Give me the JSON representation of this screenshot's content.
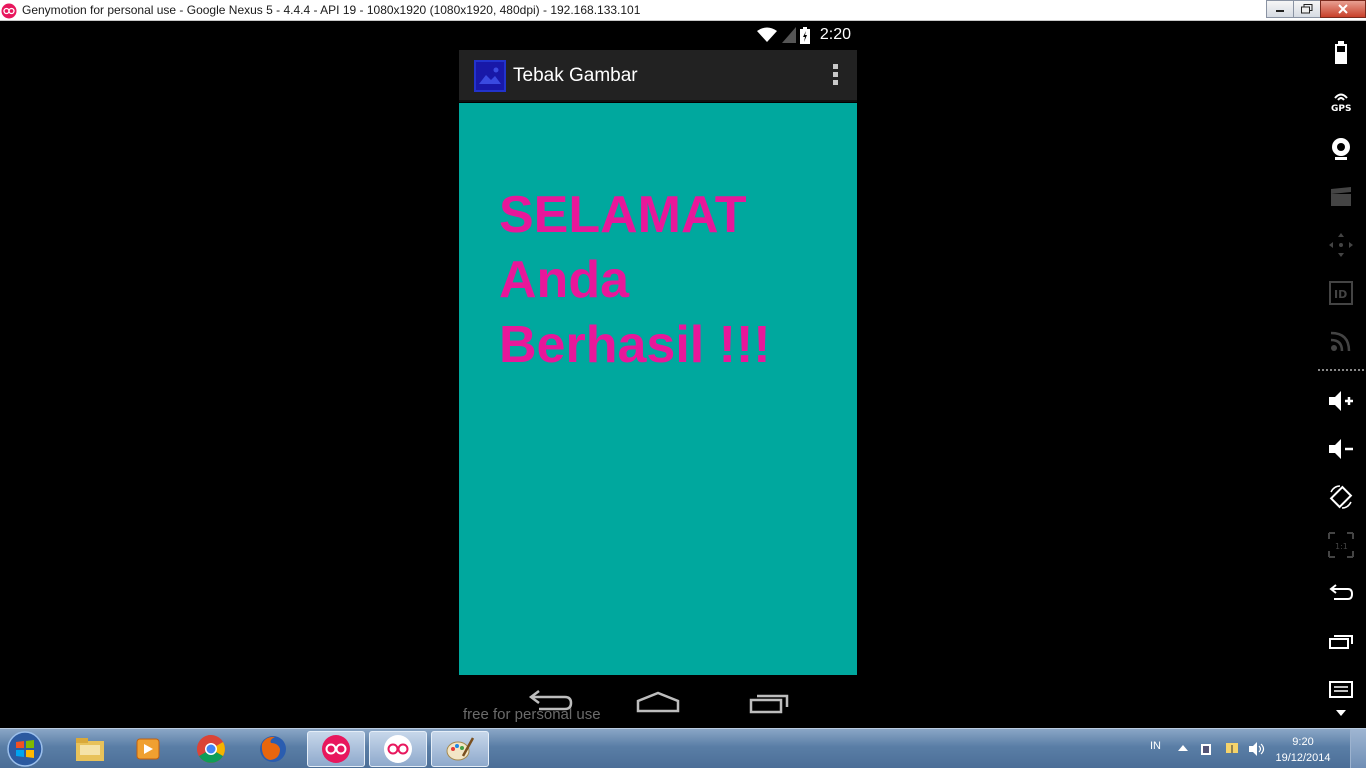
{
  "window": {
    "title": "Genymotion for personal use - Google Nexus 5 - 4.4.4 - API 19 - 1080x1920 (1080x1920, 480dpi) - 192.168.133.101",
    "controls": [
      "minimize",
      "restore",
      "close"
    ]
  },
  "status_bar": {
    "time": "2:20",
    "icons": [
      "wifi-icon",
      "signal-icon",
      "battery-charging-icon"
    ]
  },
  "action_bar": {
    "app_name": "Tebak Gambar",
    "logo_icon": "app-logo-icon",
    "menu_icon": "overflow-menu-icon"
  },
  "content": {
    "message": "SELAMAT Anda Berhasil !!!",
    "background_color": "#00a89e",
    "text_color": "#e8179a"
  },
  "nav_bar": {
    "buttons": [
      "back",
      "home",
      "recent-apps"
    ]
  },
  "watermark": "free for personal use",
  "sidebar": {
    "items": [
      "battery",
      "gps",
      "webcam",
      "capture",
      "dpad",
      "id",
      "remote-control",
      "volume-up",
      "volume-down",
      "rotate",
      "scale",
      "back",
      "recent-apps",
      "menu"
    ]
  },
  "taskbar": {
    "apps": [
      "file-explorer",
      "media-player",
      "chrome",
      "firefox",
      "genymotion",
      "genymotion-vm",
      "paint"
    ],
    "language": "IN",
    "clock_time": "9:20",
    "clock_date": "19/12/2014"
  }
}
